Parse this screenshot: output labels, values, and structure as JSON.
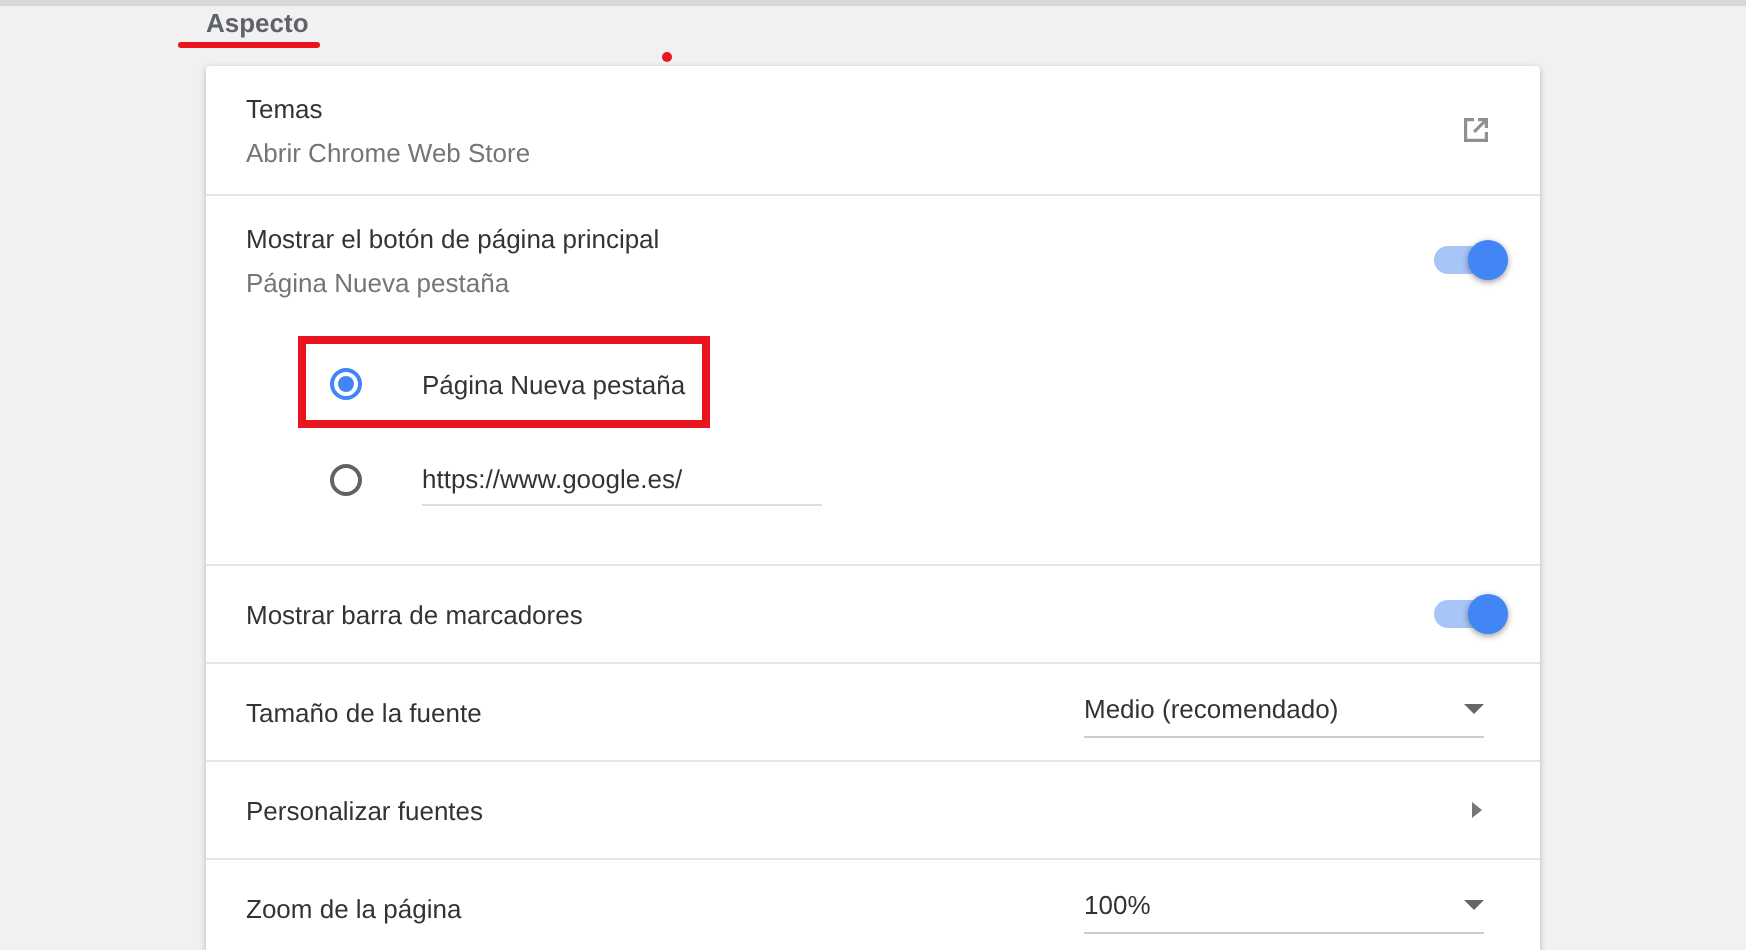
{
  "section": {
    "title": "Aspecto",
    "underlined": true
  },
  "rows": [
    {
      "kind": "link",
      "label": "Temas",
      "sublabel": "Abrir Chrome Web Store"
    },
    {
      "kind": "toggle",
      "label": "Mostrar el botón de página principal",
      "sublabel": "Página Nueva pestaña",
      "on": true,
      "options": [
        {
          "kind": "label",
          "label": "Página Nueva pestaña",
          "selected": true,
          "highlighted": true
        },
        {
          "kind": "input",
          "value": "https://www.google.es/",
          "selected": false,
          "highlighted": false
        }
      ]
    },
    {
      "kind": "toggle",
      "label": "Mostrar barra de marcadores",
      "on": true
    },
    {
      "kind": "dropdown",
      "label": "Tamaño de la fuente",
      "value": "Medio (recomendado)"
    },
    {
      "kind": "submenu",
      "label": "Personalizar fuentes"
    },
    {
      "kind": "dropdown",
      "label": "Zoom de la página",
      "value": "100%"
    }
  ]
}
